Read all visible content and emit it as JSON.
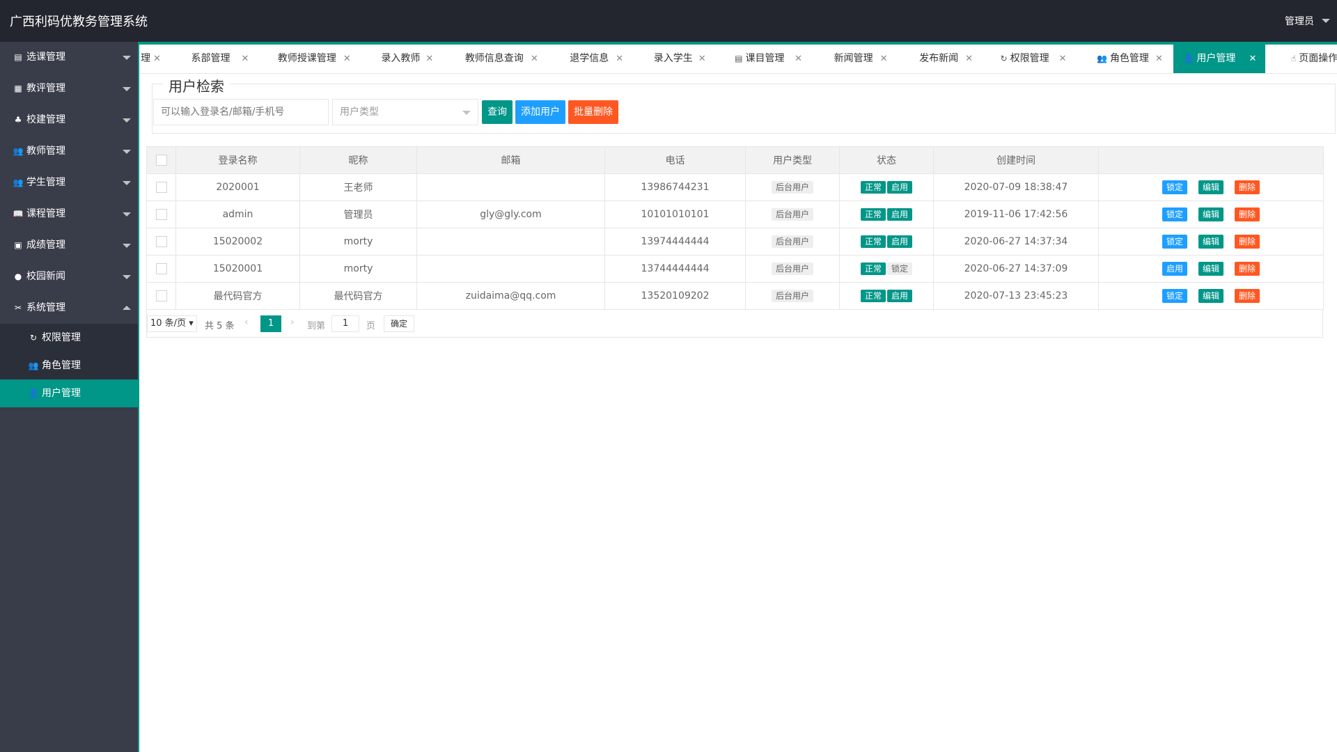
{
  "header": {
    "title": "广西利码优教务管理系统",
    "user": "管理员"
  },
  "sidebar": {
    "items": [
      {
        "label": "选课管理",
        "icon": "doc-icon"
      },
      {
        "label": "教评管理",
        "icon": "grid-icon"
      },
      {
        "label": "校建管理",
        "icon": "tree-icon"
      },
      {
        "label": "教师管理",
        "icon": "users-icon"
      },
      {
        "label": "学生管理",
        "icon": "users-icon"
      },
      {
        "label": "课程管理",
        "icon": "book-icon"
      },
      {
        "label": "成绩管理",
        "icon": "clipboard-icon"
      },
      {
        "label": "校园新闻",
        "icon": "chat-icon"
      },
      {
        "label": "系统管理",
        "icon": "tools-icon"
      }
    ],
    "sub_items": [
      {
        "label": "权限管理",
        "icon": "refresh-icon"
      },
      {
        "label": "角色管理",
        "icon": "users-icon"
      },
      {
        "label": "用户管理",
        "icon": "user-icon"
      }
    ]
  },
  "tabs": [
    {
      "label": "理"
    },
    {
      "label": "系部管理"
    },
    {
      "label": "教师授课管理"
    },
    {
      "label": "录入教师"
    },
    {
      "label": "教师信息查询"
    },
    {
      "label": "退学信息"
    },
    {
      "label": "录入学生"
    },
    {
      "label": "课目管理"
    },
    {
      "label": "新闻管理"
    },
    {
      "label": "发布新闻"
    },
    {
      "label": "权限管理"
    },
    {
      "label": "角色管理"
    },
    {
      "label": "用户管理"
    },
    {
      "label": "页面操作"
    }
  ],
  "search": {
    "legend": "用户检索",
    "placeholder": "可以输入登录名/邮箱/手机号",
    "type_placeholder": "用户类型",
    "query_button": "查询",
    "add_button": "添加用户",
    "batch_delete_button": "批量删除"
  },
  "table": {
    "headers": [
      "登录名称",
      "昵称",
      "邮箱",
      "电话",
      "用户类型",
      "状态",
      "创建时间"
    ],
    "rows": [
      {
        "login": "2020001",
        "nick": "王老师",
        "email": "",
        "phone": "13986744231",
        "type": "后台用户",
        "status": "正常",
        "state": "启用",
        "created": "2020-07-09 18:38:47",
        "toggle": "锁定",
        "edit": "编辑",
        "del": "删除"
      },
      {
        "login": "admin",
        "nick": "管理员",
        "email": "gly@gly.com",
        "phone": "10101010101",
        "type": "后台用户",
        "status": "正常",
        "state": "启用",
        "created": "2019-11-06 17:42:56",
        "toggle": "锁定",
        "edit": "编辑",
        "del": "删除"
      },
      {
        "login": "15020002",
        "nick": "morty",
        "email": "",
        "phone": "13974444444",
        "type": "后台用户",
        "status": "正常",
        "state": "启用",
        "created": "2020-06-27 14:37:34",
        "toggle": "锁定",
        "edit": "编辑",
        "del": "删除"
      },
      {
        "login": "15020001",
        "nick": "morty",
        "email": "",
        "phone": "13744444444",
        "type": "后台用户",
        "status": "正常",
        "state": "锁定",
        "created": "2020-06-27 14:37:09",
        "toggle": "启用",
        "edit": "编辑",
        "del": "删除"
      },
      {
        "login": "最代码官方",
        "nick": "最代码官方",
        "email": "zuidaima@qq.com",
        "phone": "13520109202",
        "type": "后台用户",
        "status": "正常",
        "state": "启用",
        "created": "2020-07-13 23:45:23",
        "toggle": "锁定",
        "edit": "编辑",
        "del": "删除"
      }
    ]
  },
  "pager": {
    "limit": "10 条/页",
    "count": "共 5 条",
    "current": "1",
    "goto": "到第",
    "page_input": "1",
    "page_unit": "页",
    "confirm": "确定"
  }
}
